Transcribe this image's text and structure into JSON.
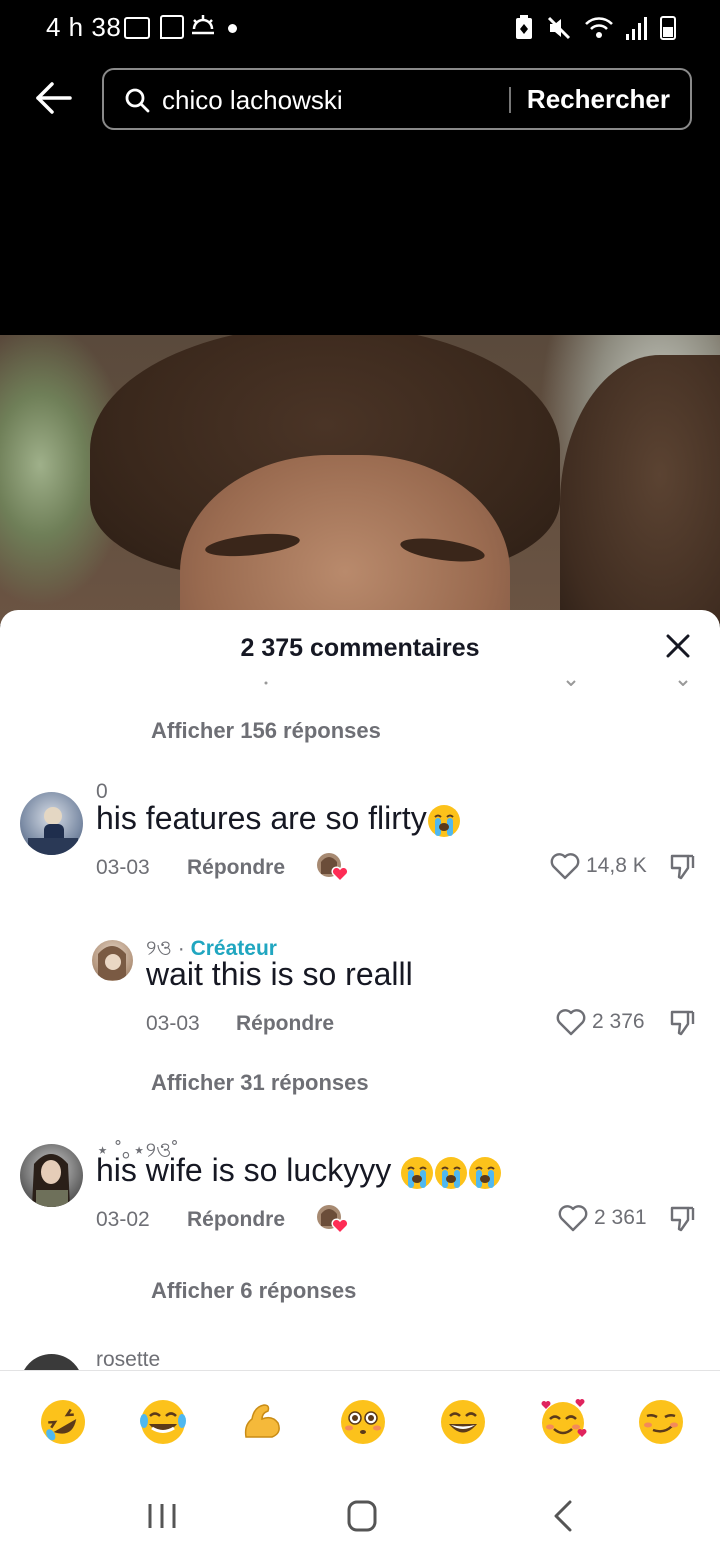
{
  "status_bar": {
    "time": "4 h 38",
    "icons": [
      "gallery-icon",
      "twitch-icon",
      "weather-icon",
      "notification-dot",
      "battery-saver-icon",
      "mute-icon",
      "wifi-icon",
      "signal-icon",
      "battery-icon"
    ]
  },
  "search": {
    "query": "chico lachowski",
    "button_label": "Rechercher"
  },
  "comments_sheet": {
    "title": "2 375 commentaires",
    "top_more_replies": "Afficher 156 réponses",
    "comments": [
      {
        "username": "0",
        "text": "his features are so flirty",
        "emoji": [
          "loudly-crying-face"
        ],
        "date": "03-03",
        "reply_label": "Répondre",
        "creator_liked": true,
        "likes": "14,8 K"
      },
      {
        "username": "୨ও",
        "creator_label": "Créateur",
        "text": "wait this is so realll",
        "date": "03-03",
        "reply_label": "Répondre",
        "likes": "2 376"
      },
      {
        "username": "⋆ ˚｡⋆୨ও˚",
        "text": "his wife is so luckyyy",
        "emoji": [
          "loudly-crying-face",
          "loudly-crying-face",
          "loudly-crying-face"
        ],
        "date": "03-02",
        "reply_label": "Répondre",
        "creator_liked": true,
        "likes": "2 361"
      },
      {
        "username": "rosette"
      }
    ],
    "more_replies_1": "Afficher 31 réponses",
    "more_replies_2": "Afficher 6 réponses"
  },
  "emoji_bar": [
    "rolling-on-floor-laughing",
    "face-with-tears-of-joy",
    "flexed-biceps",
    "flushed-face",
    "beaming-face",
    "smiling-face-with-hearts",
    "smirking-face"
  ],
  "colors": {
    "accent_creator": "#20a6c0",
    "text_secondary": "#6e6f75",
    "text_primary": "#161823"
  }
}
